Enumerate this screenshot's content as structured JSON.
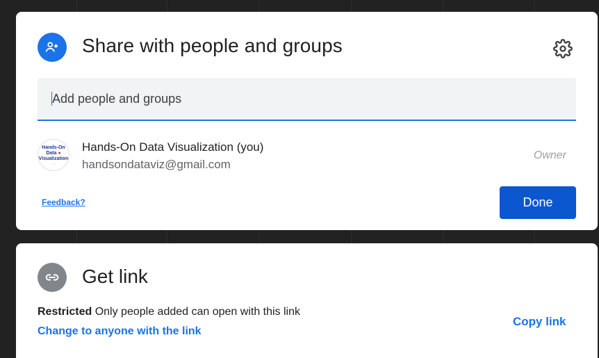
{
  "share_dialog": {
    "title": "Share with people and groups",
    "settings_icon": "gear-icon",
    "add_field": {
      "placeholder": "Add people and groups",
      "value": ""
    },
    "people": [
      {
        "name": "Hands-On Data Visualization (you)",
        "email": "handsondataviz@gmail.com",
        "role": "Owner",
        "avatar_text": [
          "Hands-On",
          "Data",
          "Visualization"
        ]
      }
    ],
    "feedback_label": "Feedback?",
    "done_label": "Done"
  },
  "get_link": {
    "title": "Get link",
    "access_level": "Restricted",
    "access_description": "Only people added can open with this link",
    "change_label": "Change to anyone with the link",
    "copy_label": "Copy link"
  },
  "colors": {
    "accent": "#1a73e8",
    "done_button": "#0b57d0",
    "link_icon_bg": "#80868b"
  }
}
